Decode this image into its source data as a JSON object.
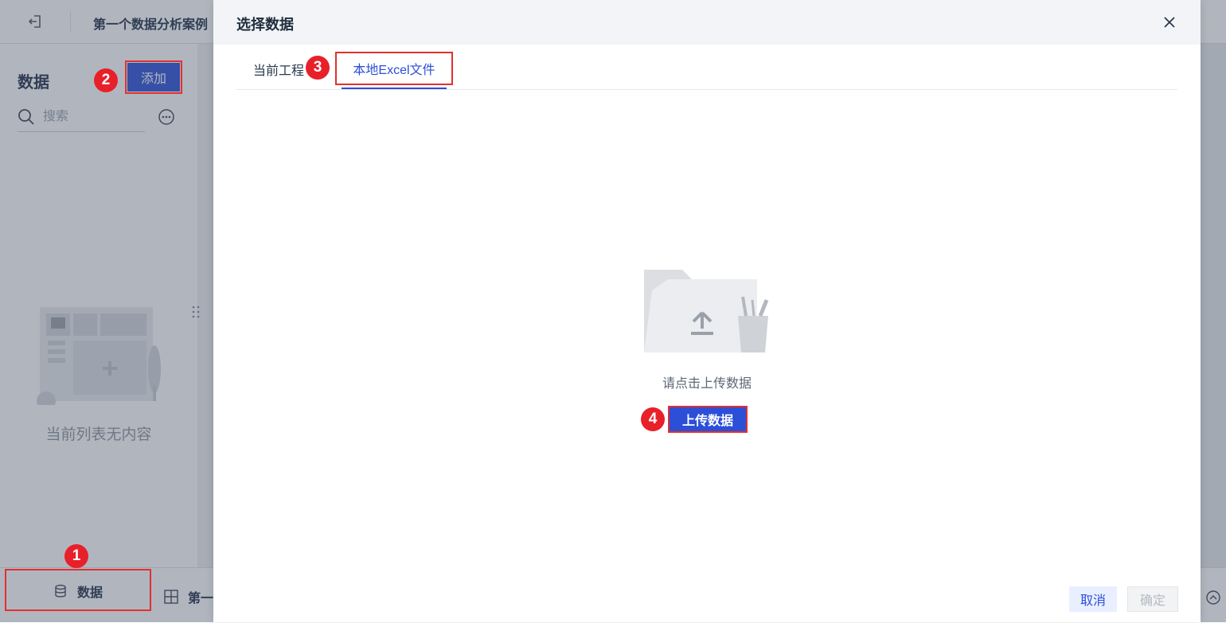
{
  "app": {
    "project_title": "第一个数据分析案例"
  },
  "sidebar": {
    "title": "数据",
    "add_label": "添加",
    "search_placeholder": "搜索",
    "empty_text": "当前列表无内容"
  },
  "bottom_bar": {
    "data_tab_label": "数据",
    "report_tab_label": "第一"
  },
  "dialog": {
    "title": "选择数据",
    "tabs": [
      {
        "label": "当前工程",
        "active": false
      },
      {
        "label": "本地Excel文件",
        "active": true
      }
    ],
    "upload_hint": "请点击上传数据",
    "upload_label": "上传数据",
    "cancel_label": "取消",
    "confirm_label": "确定"
  },
  "annotations": {
    "step1": "1",
    "step2": "2",
    "step3": "3",
    "step4": "4"
  },
  "colors": {
    "primary": "#2c4fd8",
    "annotation_red": "#e8202a"
  }
}
